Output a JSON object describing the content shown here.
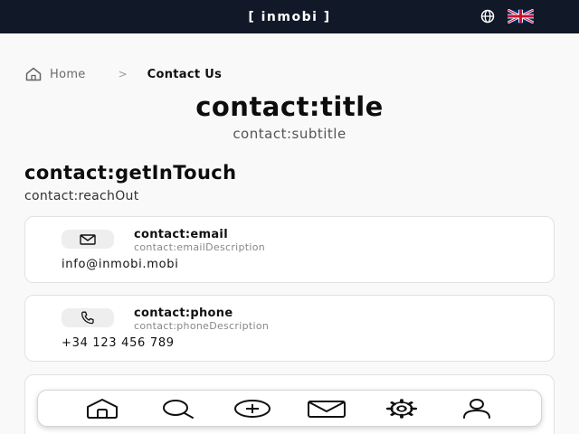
{
  "header": {
    "brand": "[ inmobi ]",
    "globe_icon": "globe-icon",
    "flag_icon": "uk-flag-icon",
    "background": "#111827"
  },
  "breadcrumb": {
    "home": "Home",
    "separator": ">",
    "current": "Contact Us",
    "home_icon": "home-icon"
  },
  "page": {
    "title": "contact:title",
    "subtitle": "contact:subtitle"
  },
  "section": {
    "title": "contact:getInTouch",
    "subtitle": "contact:reachOut"
  },
  "cards": {
    "email": {
      "icon": "mail-icon",
      "label": "contact:email",
      "description": "contact:emailDescription",
      "value": "info@inmobi.mobi"
    },
    "phone": {
      "icon": "phone-icon",
      "label": "contact:phone",
      "description": "contact:phoneDescription",
      "value": "+34 123 456 789"
    }
  },
  "bottom_nav": {
    "items": [
      "home-icon",
      "search-icon",
      "add-icon",
      "mail-icon",
      "settings-icon",
      "user-icon"
    ]
  }
}
